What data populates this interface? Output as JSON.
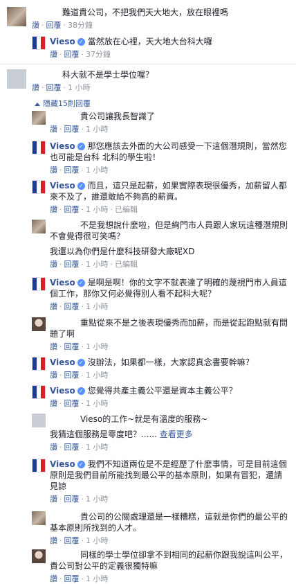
{
  "comments": [
    {
      "text": "難道貴公司，不把我們天大地大，放在眼裡嗎",
      "like": "讚",
      "reply": "回覆",
      "time": "38分鐘"
    },
    {
      "name": "Vieso",
      "text": "當然放在心裡，天大地大台科大囉",
      "like": "讚",
      "reply": "回覆",
      "time": "37分鐘"
    },
    {
      "text": "科大就不是學士學位喔？",
      "like": "讚",
      "reply": "回覆",
      "time": "1 小時"
    },
    {
      "text": "貴公司讓我長智識了",
      "like": "讚",
      "reply": "回覆",
      "time": "1 小時"
    },
    {
      "name": "Vieso",
      "text": "那您應該去外面的大公司感受一下這個潛規則，當然您也可能是台科 北科的學生啦！",
      "like": "讚",
      "reply": "回覆",
      "time": "1 小時"
    },
    {
      "name": "Vieso",
      "text": "而且，這只是起薪，如果實際表現很優秀，加薪留人都來不及了，誰還敢給不夠高的薪資。",
      "like": "讚",
      "reply": "回覆",
      "time": "1 小時",
      "edited": "已編輯"
    },
    {
      "text": "不是我想說什麼啦，但是絢門市人員跟人家玩這種潛規則不會覺得很可笑嗎？",
      "text2": "我還以為你們是什麼科技研發大廠呢XD",
      "like": "讚",
      "reply": "回覆",
      "time": "1 小時",
      "edited": "已編輯"
    },
    {
      "name": "Vieso",
      "text": "是啊是啊！你的文字不就表達了明確的蔑視門市人員這個工作，那你又何必覺得別人看不起科大呢？",
      "like": "讚",
      "reply": "回覆",
      "time": "1 小時"
    },
    {
      "text": "重點從來不是之後表現優秀而加薪，而是從起跑點就有問題了啊",
      "like": "讚",
      "reply": "回覆",
      "time": "1 小時"
    },
    {
      "name": "Vieso",
      "text": "沒辦法，如果都一樣，大家認真念書要幹嘛？",
      "like": "讚",
      "reply": "回覆",
      "time": "1 小時"
    },
    {
      "name": "Vieso",
      "text": "您覺得共產主義公平還是資本主義公平？",
      "like": "讚",
      "reply": "回覆",
      "time": "1 小時"
    },
    {
      "text": "Vieso的工作~就是有溫度的服務~",
      "text2": "我猜這個服務是零度吧？......",
      "more": "查看更多",
      "like": "讚",
      "reply": "回覆",
      "time": "1 小時"
    },
    {
      "name": "Vieso",
      "text": "我們不知道兩位是不是經歷了什麼事情，可是目前這個原則是我們目前所能找到最公平的基本原則，如果有冒犯，還請見諒",
      "like": "讚",
      "reply": "回覆",
      "time": "1 小時"
    },
    {
      "text": "貴公司的公關處理還是一樣糟糕，這就是你們的最公平的基本原則所找到的人才。",
      "like": "讚",
      "reply": "回覆",
      "time": "1 小時"
    },
    {
      "text": "同樣的學士學位卻拿不到相同的起薪你跟我說這叫公平，貴公司對公平的定義很獨特嘛",
      "like": "讚",
      "reply": "回覆",
      "time": "1 小時"
    }
  ],
  "hidden_toggle": "隱藏15則回覆",
  "verified_glyph": "✓"
}
